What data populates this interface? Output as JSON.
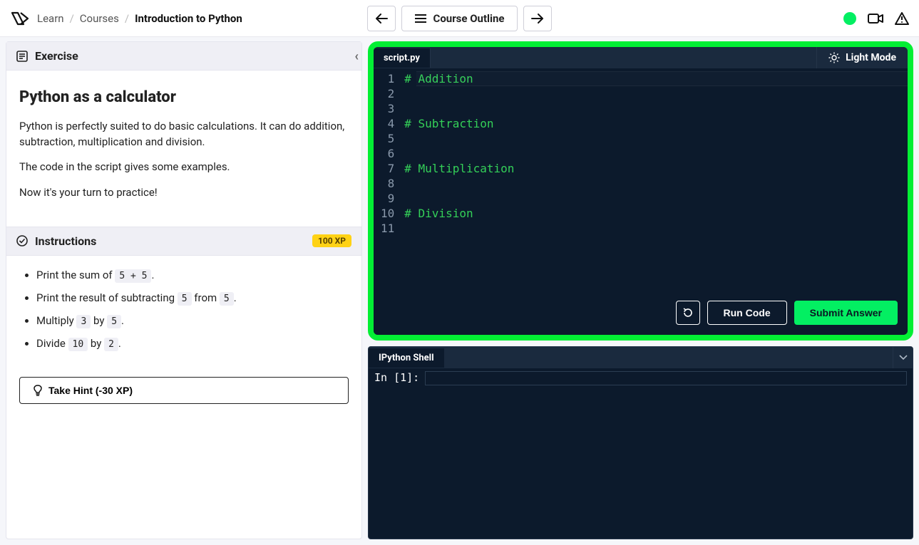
{
  "breadcrumb": {
    "learn": "Learn",
    "courses": "Courses",
    "current": "Introduction to Python"
  },
  "topnav": {
    "outline_label": "Course Outline"
  },
  "exercise": {
    "header": "Exercise",
    "title": "Python as a calculator",
    "p1": "Python is perfectly suited to do basic calculations. It can do addition, subtraction, multiplication and division.",
    "p2": "The code in the script gives some examples.",
    "p3": "Now it's your turn to practice!"
  },
  "instructions": {
    "header": "Instructions",
    "xp": "100 XP",
    "items": [
      {
        "pre": "Print the sum of ",
        "codes": [
          "5 + 5"
        ],
        "mids": [],
        "post": "."
      },
      {
        "pre": "Print the result of subtracting ",
        "codes": [
          "5",
          "5"
        ],
        "mids": [
          " from "
        ],
        "post": "."
      },
      {
        "pre": "Multiply ",
        "codes": [
          "3",
          "5"
        ],
        "mids": [
          " by "
        ],
        "post": "."
      },
      {
        "pre": "Divide ",
        "codes": [
          "10",
          "2"
        ],
        "mids": [
          " by "
        ],
        "post": "."
      }
    ],
    "hint": "Take Hint (-30 XP)"
  },
  "editor": {
    "filename": "script.py",
    "light_mode": "Light Mode",
    "line_numbers": [
      "1",
      "2",
      "3",
      "4",
      "5",
      "6",
      "7",
      "8",
      "9",
      "10",
      "11"
    ],
    "lines": [
      {
        "text": "# Addition",
        "cls": "comment"
      },
      {
        "text": "",
        "cls": ""
      },
      {
        "text": "",
        "cls": ""
      },
      {
        "text": "# Subtraction",
        "cls": "comment"
      },
      {
        "text": "",
        "cls": ""
      },
      {
        "text": "",
        "cls": ""
      },
      {
        "text": "# Multiplication",
        "cls": "comment"
      },
      {
        "text": "",
        "cls": ""
      },
      {
        "text": "",
        "cls": ""
      },
      {
        "text": "# Division",
        "cls": "comment"
      },
      {
        "text": "",
        "cls": ""
      }
    ],
    "run": "Run Code",
    "submit": "Submit Answer"
  },
  "shell": {
    "tab": "IPython Shell",
    "prompt": "In [1]:"
  }
}
